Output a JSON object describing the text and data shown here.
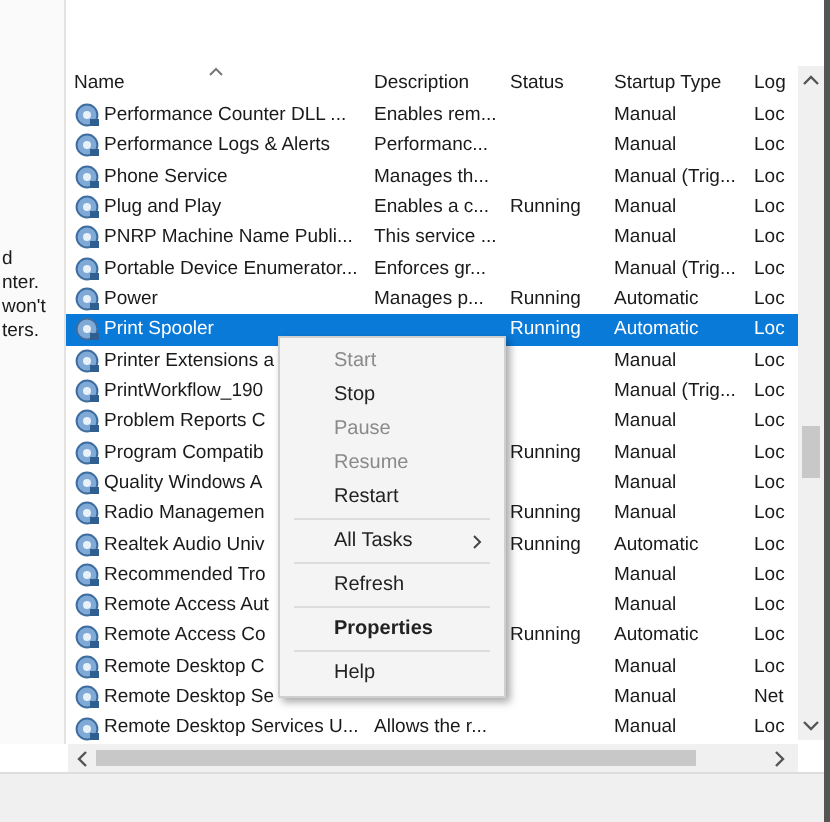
{
  "left_pane": {
    "lines": [
      "d",
      "nter.",
      "won't",
      "ters."
    ]
  },
  "table": {
    "columns": [
      {
        "label": "Name",
        "sorted": true
      },
      {
        "label": "Description",
        "sorted": false
      },
      {
        "label": "Status",
        "sorted": false
      },
      {
        "label": "Startup Type",
        "sorted": false
      },
      {
        "label": "Log",
        "sorted": false
      }
    ],
    "rows": [
      {
        "name": "Performance Counter DLL ...",
        "description": "Enables rem...",
        "status": "",
        "startup_type": "Manual",
        "log_on_as": "Loc",
        "selected": false
      },
      {
        "name": "Performance Logs & Alerts",
        "description": "Performanc...",
        "status": "",
        "startup_type": "Manual",
        "log_on_as": "Loc",
        "selected": false
      },
      {
        "name": "Phone Service",
        "description": "Manages th...",
        "status": "",
        "startup_type": "Manual (Trig...",
        "log_on_as": "Loc",
        "selected": false
      },
      {
        "name": "Plug and Play",
        "description": "Enables a c...",
        "status": "Running",
        "startup_type": "Manual",
        "log_on_as": "Loc",
        "selected": false
      },
      {
        "name": "PNRP Machine Name Publi...",
        "description": "This service ...",
        "status": "",
        "startup_type": "Manual",
        "log_on_as": "Loc",
        "selected": false
      },
      {
        "name": "Portable Device Enumerator...",
        "description": "Enforces gr...",
        "status": "",
        "startup_type": "Manual (Trig...",
        "log_on_as": "Loc",
        "selected": false
      },
      {
        "name": "Power",
        "description": "Manages p...",
        "status": "Running",
        "startup_type": "Automatic",
        "log_on_as": "Loc",
        "selected": false
      },
      {
        "name": "Print Spooler",
        "description": "",
        "status": "Running",
        "startup_type": "Automatic",
        "log_on_as": "Loc",
        "selected": true
      },
      {
        "name": "Printer Extensions a",
        "description": "",
        "status": "",
        "startup_type": "Manual",
        "log_on_as": "Loc",
        "selected": false
      },
      {
        "name": "PrintWorkflow_190",
        "description": "",
        "status": "",
        "startup_type": "Manual (Trig...",
        "log_on_as": "Loc",
        "selected": false
      },
      {
        "name": "Problem Reports C",
        "description": "",
        "status": "",
        "startup_type": "Manual",
        "log_on_as": "Loc",
        "selected": false
      },
      {
        "name": "Program Compatib",
        "description": "",
        "status": "Running",
        "startup_type": "Manual",
        "log_on_as": "Loc",
        "selected": false
      },
      {
        "name": "Quality Windows A",
        "description": "",
        "status": "",
        "startup_type": "Manual",
        "log_on_as": "Loc",
        "selected": false
      },
      {
        "name": "Radio Managemen",
        "description": "",
        "status": "Running",
        "startup_type": "Manual",
        "log_on_as": "Loc",
        "selected": false
      },
      {
        "name": "Realtek Audio Univ",
        "description": "",
        "status": "Running",
        "startup_type": "Automatic",
        "log_on_as": "Loc",
        "selected": false
      },
      {
        "name": "Recommended Tro",
        "description": "",
        "status": "",
        "startup_type": "Manual",
        "log_on_as": "Loc",
        "selected": false
      },
      {
        "name": "Remote Access Aut",
        "description": "",
        "status": "",
        "startup_type": "Manual",
        "log_on_as": "Loc",
        "selected": false
      },
      {
        "name": "Remote Access Co",
        "description": "",
        "status": "Running",
        "startup_type": "Automatic",
        "log_on_as": "Loc",
        "selected": false
      },
      {
        "name": "Remote Desktop C",
        "description": "",
        "status": "",
        "startup_type": "Manual",
        "log_on_as": "Loc",
        "selected": false
      },
      {
        "name": "Remote Desktop Se",
        "description": "",
        "status": "",
        "startup_type": "Manual",
        "log_on_as": "Net",
        "selected": false
      },
      {
        "name": "Remote Desktop Services U...",
        "description": "Allows the r...",
        "status": "",
        "startup_type": "Manual",
        "log_on_as": "Loc",
        "selected": false
      }
    ]
  },
  "context_menu": {
    "items": [
      {
        "kind": "item",
        "label": "Start",
        "disabled": true,
        "bold": false,
        "submenu": false
      },
      {
        "kind": "item",
        "label": "Stop",
        "disabled": false,
        "bold": false,
        "submenu": false
      },
      {
        "kind": "item",
        "label": "Pause",
        "disabled": true,
        "bold": false,
        "submenu": false
      },
      {
        "kind": "item",
        "label": "Resume",
        "disabled": true,
        "bold": false,
        "submenu": false
      },
      {
        "kind": "item",
        "label": "Restart",
        "disabled": false,
        "bold": false,
        "submenu": false
      },
      {
        "kind": "separator"
      },
      {
        "kind": "item",
        "label": "All Tasks",
        "disabled": false,
        "bold": false,
        "submenu": true
      },
      {
        "kind": "separator"
      },
      {
        "kind": "item",
        "label": "Refresh",
        "disabled": false,
        "bold": false,
        "submenu": false
      },
      {
        "kind": "separator"
      },
      {
        "kind": "item",
        "label": "Properties",
        "disabled": false,
        "bold": true,
        "submenu": false
      },
      {
        "kind": "separator"
      },
      {
        "kind": "item",
        "label": "Help",
        "disabled": false,
        "bold": false,
        "submenu": false
      }
    ]
  }
}
